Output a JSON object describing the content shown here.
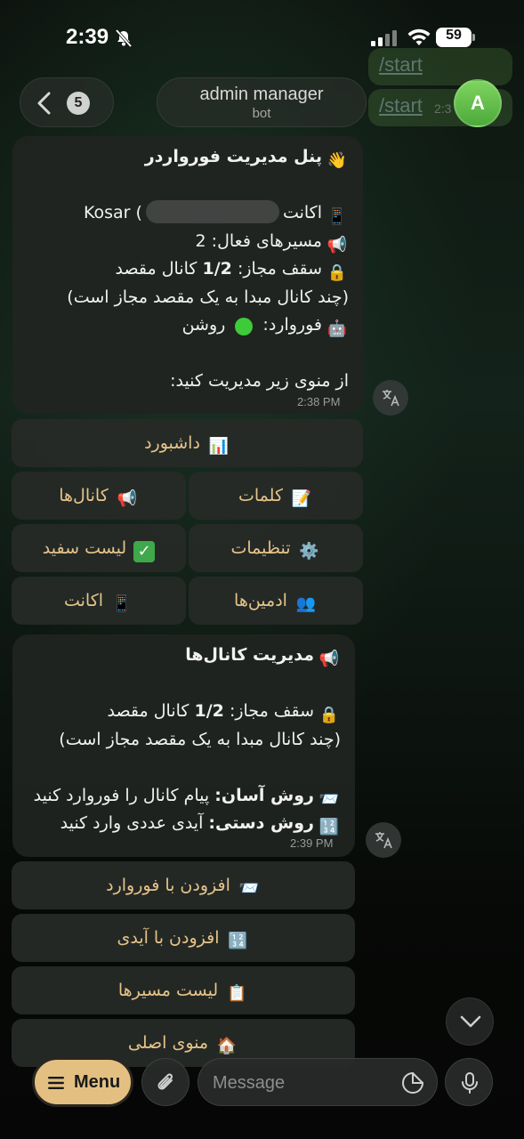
{
  "status_bar": {
    "time": "2:39",
    "battery": "59"
  },
  "header": {
    "unread_count": "5",
    "chat_name": "admin manager",
    "chat_subtitle": "bot",
    "avatar_letter": "A",
    "prev_command_1": "/start",
    "prev_command_2": "/start",
    "prev_time": "2:3"
  },
  "message1": {
    "title": "پنل مدیریت فورواردر",
    "account_label": "اکانت",
    "account_value": "Kosar (",
    "active_routes": "مسیرهای فعال: 2",
    "limit_prefix": "سقف مجاز:",
    "limit_value": "1/2",
    "limit_suffix": "کانال مقصد",
    "limit_note": "(چند کانال مبدا به یک مقصد مجاز است)",
    "forward_label": "فوروارد:",
    "forward_value": "روشن",
    "instruction": "از منوی زیر مدیریت کنید:",
    "time": "2:38 PM"
  },
  "keyboard1": {
    "dashboard": "داشبورد",
    "words": "کلمات",
    "channels": "کانال‌ها",
    "settings": "تنظیمات",
    "whitelist": "لیست سفید",
    "admins": "ادمین‌ها",
    "account": "اکانت"
  },
  "message2": {
    "title": "مدیریت کانال‌ها",
    "limit_prefix": "سقف مجاز:",
    "limit_value": "1/2",
    "limit_suffix": "کانال مقصد",
    "limit_note": "(چند کانال مبدا به یک مقصد مجاز است)",
    "easy_label": "روش آسان:",
    "easy_text": "پیام کانال را فوروارد کنید",
    "manual_label": "روش دستی:",
    "manual_text": "آیدی عددی وارد کنید",
    "time": "2:39 PM"
  },
  "keyboard2": {
    "add_forward": "افزودن با فوروارد",
    "add_id": "افزودن با آیدی",
    "routes_list": "لیست مسیرها",
    "main_menu": "منوی اصلی"
  },
  "input_bar": {
    "menu_label": "Menu",
    "placeholder": "Message"
  },
  "colors": {
    "button_text": "#e6c489",
    "menu_button": "#e3c081",
    "avatar": "#6cc24f",
    "bubble": "#202421"
  }
}
